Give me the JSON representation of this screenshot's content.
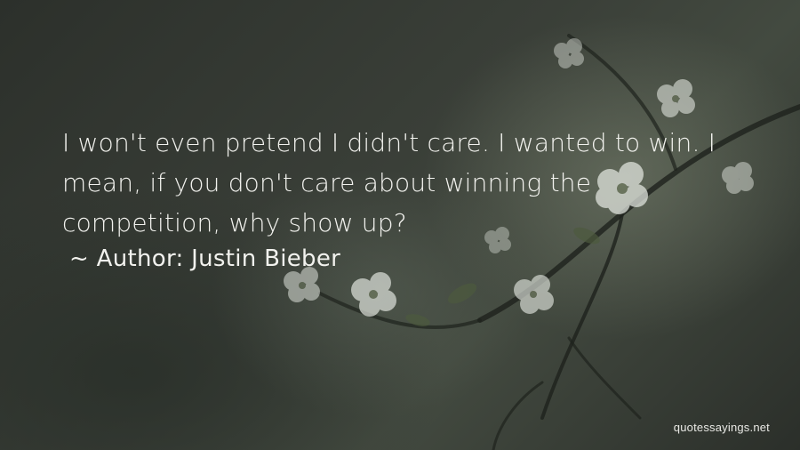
{
  "quote": {
    "text": "I won't even pretend I didn't care. I wanted to win. I mean, if you don't care about winning the competition, why show up?",
    "attribution": "~ Author: Justin Bieber"
  },
  "watermark": {
    "text": "quotessayings.net"
  },
  "colors": {
    "text": "#f2f2ee",
    "background": "#3a3f38",
    "blossom": "#dfe3dc"
  }
}
